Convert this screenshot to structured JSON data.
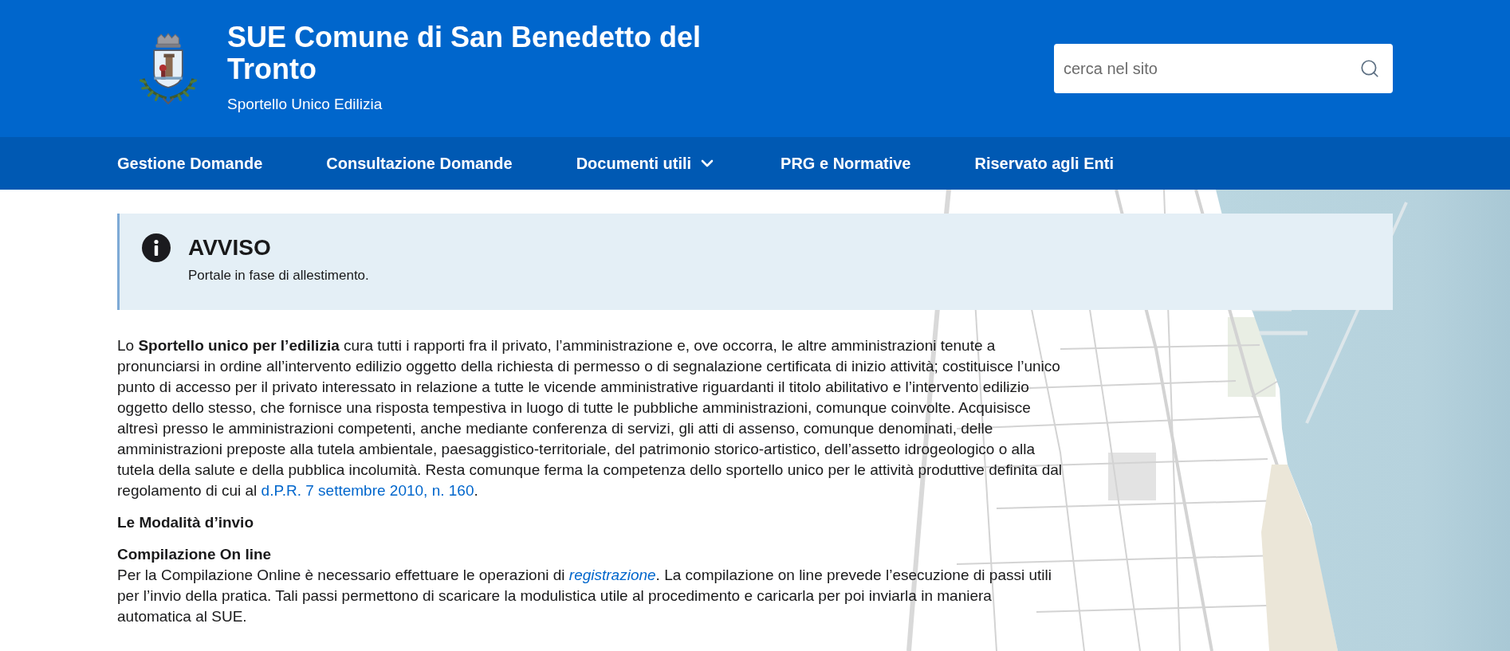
{
  "header": {
    "title": "SUE Comune di San Benedetto del Tronto",
    "subtitle": "Sportello Unico Edilizia",
    "search": {
      "placeholder": "cerca nel sito"
    }
  },
  "nav": {
    "items": [
      {
        "label": "Gestione Domande",
        "kind": "link"
      },
      {
        "label": "Consultazione Domande",
        "kind": "link"
      },
      {
        "label": "Documenti utili",
        "kind": "dropdown"
      },
      {
        "label": "PRG e Normative",
        "kind": "link"
      },
      {
        "label": "Riservato agli Enti",
        "kind": "link"
      }
    ]
  },
  "notice": {
    "title": "AVVISO",
    "message": "Portale in fase di allestimento."
  },
  "content": {
    "intro": {
      "text": "Lo **Sportello unico per l’edilizia** cura tutti i rapporti fra il privato, l’amministrazione e, ove occorra, le altre amministrazioni tenute a pronunciarsi in ordine all’intervento edilizio oggetto della richiesta di permesso o di segnalazione certificata di inizio attività; costituisce l’unico punto di accesso per il privato interessato in relazione a tutte le vicende amministrative riguardanti il titolo abilitativo e l’intervento edilizio oggetto dello stesso, che fornisce una risposta tempestiva in luogo di tutte le pubbliche amministrazioni, comunque coinvolte. Acquisisce altresì presso le amministrazioni competenti, anche mediante conferenza di servizi, gli atti di assenso, comunque denominati, delle amministrazioni preposte alla tutela ambientale, paesaggistico-territoriale, del patrimonio storico-artistico, dell’assetto idrogeologico o alla tutela della salute e della pubblica incolumità. Resta comunque ferma la competenza dello sportello unico per le attività produttive definita dal regolamento di cui al",
      "link": "d.P.R. 7 settembre 2010, n. 160",
      "after": "."
    },
    "heading": "Le Modalità d’invio",
    "subheading": "Compilazione On line",
    "body": {
      "text": "Per la Compilazione Online è necessario effettuare le operazioni di",
      "link": "registrazione",
      "after": ". La compilazione on line prevede l’esecuzione di passi utili per l’invio della pratica. Tali passi permettono di scaricare la modulistica utile al procedimento e caricarla per poi inviarla in maniera automatica al SUE."
    }
  }
}
